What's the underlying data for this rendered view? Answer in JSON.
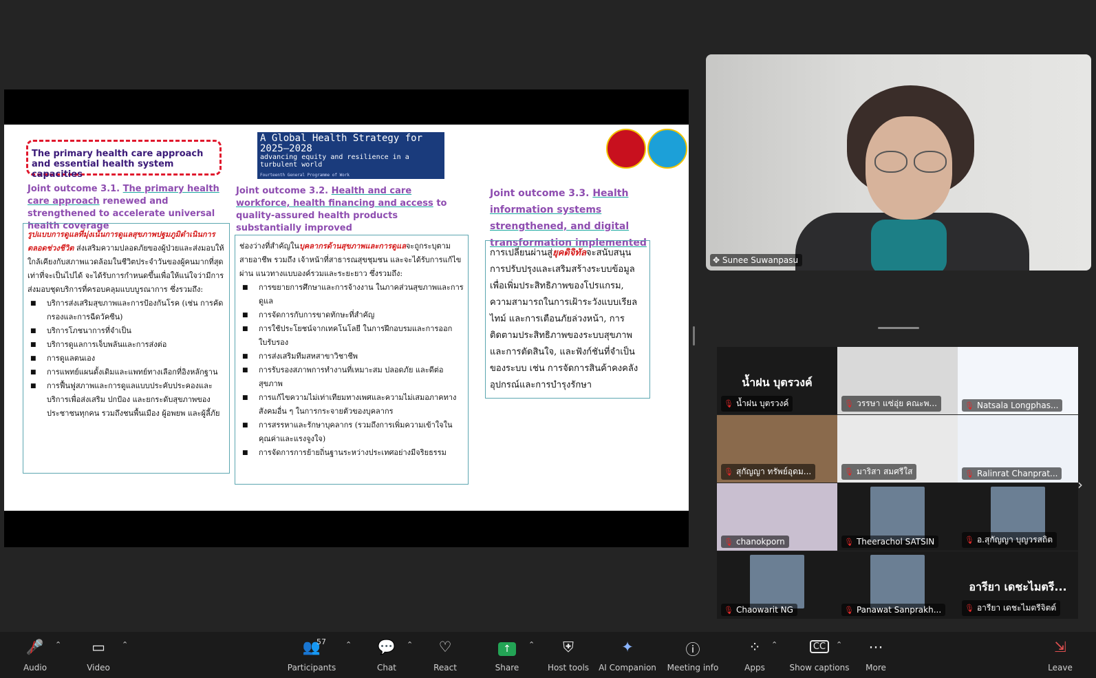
{
  "slide": {
    "title_box": "The primary health care approach and essential health system capacities",
    "strategy": {
      "line1": "A Global Health Strategy for 2025–2028",
      "line2": "advancing equity and resilience in a turbulent world",
      "line3": "Fourteenth General Programme of Work"
    },
    "col1": {
      "prefix": "Joint outcome 3.1.",
      "heading_ul": "The primary health care approach",
      "heading_rest": "renewed and strengthened to accelerate universal health coverage",
      "intro_red": "รูปแบบการดูแลที่มุ่งเน้นการดูแลสุขภาพปฐมภูมิดำเนินการตลอดช่วงชีวิต",
      "intro": "ส่งเสริมความปลอดภัยของผู้ป่วยและส่งมอบให้ใกล้เคียงกับสภาพแวดล้อมในชีวิตประจำวันของผู้คนมากที่สุดเท่าที่จะเป็นไปได้ จะได้รับการกำหนดขึ้นเพื่อให้แน่ใจว่ามีการส่งมอบชุดบริการที่ครอบคลุมแบบบูรณาการ ซึ่งรวมถึง:",
      "items": [
        "บริการส่งเสริมสุขภาพและการป้องกันโรค (เช่น การคัดกรองและการฉีดวัคซีน)",
        "บริการโภชนาการที่จำเป็น",
        "บริการดูแลการเจ็บพลันและการส่งต่อ",
        "การดูแลตนเอง",
        "การแพทย์แผนดั้งเดิมและแพทย์ทางเลือกที่อิงหลักฐาน",
        "การฟื้นฟูสภาพและการดูแลแบบประคับประคองและบริการเพื่อส่งเสริม ปกป้อง และยกระดับสุขภาพของประชาชนทุกคน รวมถึงชนพื้นเมือง ผู้อพยพ และผู้ลี้ภัย"
      ]
    },
    "col2": {
      "prefix": "Joint outcome 3.2.",
      "heading_ul": "Health and care workforce, health financing and access",
      "heading_rest": "to quality-assured health products substantially improved",
      "intro_a": "ช่องว่างที่สำคัญใน",
      "intro_red": "บุคลากรด้านสุขภาพและการดูแล",
      "intro_b": "จะถูกระบุตามสายอาชีพ รวมถึง เจ้าหน้าที่สาธารณสุขชุมชน และจะได้รับการแก้ไขผ่าน แนวทางแบบองค์รวมและระยะยาว ซึ่งรวมถึง:",
      "items": [
        "การขยายการศึกษาและการจ้างงาน ในภาคส่วนสุขภาพและการดูแล",
        "การจัดการกับการขาดทักษะที่สำคัญ",
        "การใช้ประโยชน์จากเทคโนโลยี ในการฝึกอบรมและการออกใบรับรอง",
        "การส่งเสริมทีมสหสาขาวิชาชีพ",
        "การรับรองสภาพการทำงานที่เหมาะสม ปลอดภัย และดีต่อสุขภาพ",
        "การแก้ไขความไม่เท่าเทียมทางเพศและความไม่เสมอภาคทางสังคมอื่น ๆ ในการกระจายตัวของบุคลากร",
        "การสรรหาและรักษาบุคลากร (รวมถึงการเพิ่มความเข้าใจในคุณค่าและแรงจูงใจ)",
        "การจัดการการย้ายถิ่นฐานระหว่างประเทศอย่างมีจริยธรรม"
      ]
    },
    "col3": {
      "prefix": "Joint outcome 3.3.",
      "heading_ul": "Health information systems strengthened, and digital transformation implemented",
      "intro_a": "การเปลี่ยนผ่านสู่",
      "intro_red": "ยุคดิจิทัล",
      "intro_b": "จะสนับสนุนการปรับปรุงและเสริมสร้างระบบข้อมูลเพื่อเพิ่มประสิทธิภาพของโปรแกรม, ความสามารถในการเฝ้าระวังแบบเรียลไทม์ และการเตือนภัยล่วงหน้า, การติดตามประสิทธิภาพของระบบสุขภาพและการตัดสินใจ, และฟังก์ชันที่จำเป็นของระบบ เช่น การจัดการสินค้าคงคลังอุปกรณ์และการบำรุงรักษา"
    }
  },
  "speaker": {
    "name": "Sunee Suwanpasu"
  },
  "gallery": [
    {
      "name": "น้ำฝน บุตรวงค์",
      "big": "น้ำฝน บุตรวงค์",
      "bg": "#1a1a1a"
    },
    {
      "name": "วรรษา แซ่อุ่ย คณะพ...",
      "bg": "#d9d9d9"
    },
    {
      "name": "Natsala Longphas...",
      "bg": "#f3f6fb"
    },
    {
      "name": "สุกัญญา ทรัพย์อุดม...",
      "bg": "#8a6a4c"
    },
    {
      "name": "มาริสา สมศรีใส",
      "bg": "#e9e9e9"
    },
    {
      "name": "Ralinrat Chanprat...",
      "bg": "#eef2f8"
    },
    {
      "name": "chanokporn",
      "bg": "#c9bfd0"
    },
    {
      "name": "Theerachol SATSIN",
      "bg": "#1a1a1a"
    },
    {
      "name": "อ.สุกัญญา บุญวรสถิต",
      "bg": "#1a1a1a"
    },
    {
      "name": "Chaowarit NG",
      "bg": "#1a1a1a"
    },
    {
      "name": "Panawat Sanprakh...",
      "bg": "#1a1a1a"
    },
    {
      "name": "อารียา เดชะไมตรีจิตต์",
      "big": "อารียา เดชะไมตรี...",
      "bg": "#1a1a1a"
    }
  ],
  "toolbar": {
    "audio": "Audio",
    "video": "Video",
    "participants": "Participants",
    "participants_count": "57",
    "chat": "Chat",
    "react": "React",
    "share": "Share",
    "host_tools": "Host tools",
    "ai": "AI Companion",
    "meeting_info": "Meeting info",
    "apps": "Apps",
    "captions": "Show captions",
    "more": "More",
    "leave": "Leave"
  }
}
